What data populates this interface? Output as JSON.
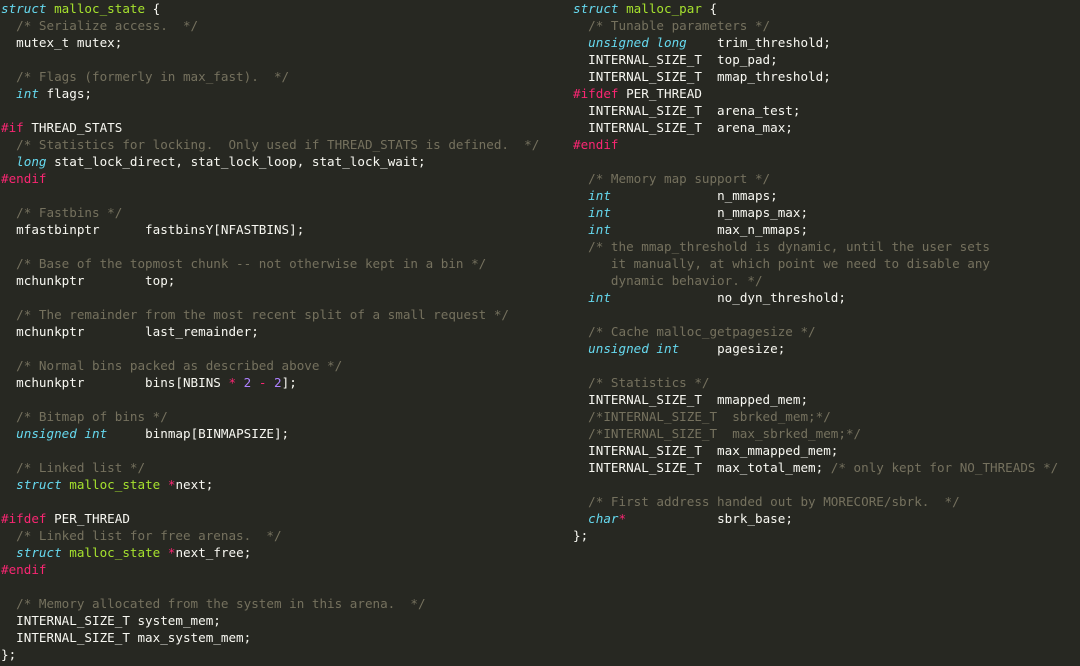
{
  "colors": {
    "background": "#272822",
    "text": "#f8f8f2",
    "keyword": "#66d9ef",
    "type_name": "#a6e22e",
    "comment": "#75715e",
    "preprocessor": "#f92672",
    "number": "#ae81ff"
  },
  "left_pane": {
    "lines": [
      [
        [
          "kw",
          "struct"
        ],
        [
          "pl",
          " "
        ],
        [
          "ty",
          "malloc_state"
        ],
        [
          "pl",
          " {"
        ]
      ],
      [
        [
          "cm",
          "  /* Serialize access.  */"
        ]
      ],
      [
        [
          "pl",
          "  mutex_t mutex;"
        ]
      ],
      [],
      [
        [
          "cm",
          "  /* Flags (formerly in max_fast).  */"
        ]
      ],
      [
        [
          "pl",
          "  "
        ],
        [
          "kw",
          "int"
        ],
        [
          "pl",
          " flags;"
        ]
      ],
      [],
      [
        [
          "pp",
          "#if"
        ],
        [
          "pl",
          " THREAD_STATS"
        ]
      ],
      [
        [
          "cm",
          "  /* Statistics for locking.  Only used if THREAD_STATS is defined.  */"
        ]
      ],
      [
        [
          "pl",
          "  "
        ],
        [
          "kw",
          "long"
        ],
        [
          "pl",
          " stat_lock_direct, stat_lock_loop, stat_lock_wait;"
        ]
      ],
      [
        [
          "pp",
          "#endif"
        ]
      ],
      [],
      [
        [
          "cm",
          "  /* Fastbins */"
        ]
      ],
      [
        [
          "pl",
          "  mfastbinptr      fastbinsY[NFASTBINS];"
        ]
      ],
      [],
      [
        [
          "cm",
          "  /* Base of the topmost chunk -- not otherwise kept in a bin */"
        ]
      ],
      [
        [
          "pl",
          "  mchunkptr        top;"
        ]
      ],
      [],
      [
        [
          "cm",
          "  /* The remainder from the most recent split of a small request */"
        ]
      ],
      [
        [
          "pl",
          "  mchunkptr        last_remainder;"
        ]
      ],
      [],
      [
        [
          "cm",
          "  /* Normal bins packed as described above */"
        ]
      ],
      [
        [
          "pl",
          "  mchunkptr        bins[NBINS "
        ],
        [
          "op",
          "*"
        ],
        [
          "pl",
          " "
        ],
        [
          "nu",
          "2"
        ],
        [
          "pl",
          " "
        ],
        [
          "op",
          "-"
        ],
        [
          "pl",
          " "
        ],
        [
          "nu",
          "2"
        ],
        [
          "pl",
          "];"
        ]
      ],
      [],
      [
        [
          "cm",
          "  /* Bitmap of bins */"
        ]
      ],
      [
        [
          "pl",
          "  "
        ],
        [
          "kw",
          "unsigned int"
        ],
        [
          "pl",
          "     binmap[BINMAPSIZE];"
        ]
      ],
      [],
      [
        [
          "cm",
          "  /* Linked list */"
        ]
      ],
      [
        [
          "pl",
          "  "
        ],
        [
          "kw",
          "struct"
        ],
        [
          "pl",
          " "
        ],
        [
          "ty",
          "malloc_state"
        ],
        [
          "pl",
          " "
        ],
        [
          "op",
          "*"
        ],
        [
          "pl",
          "next;"
        ]
      ],
      [],
      [
        [
          "pp",
          "#ifdef"
        ],
        [
          "pl",
          " PER_THREAD"
        ]
      ],
      [
        [
          "cm",
          "  /* Linked list for free arenas.  */"
        ]
      ],
      [
        [
          "pl",
          "  "
        ],
        [
          "kw",
          "struct"
        ],
        [
          "pl",
          " "
        ],
        [
          "ty",
          "malloc_state"
        ],
        [
          "pl",
          " "
        ],
        [
          "op",
          "*"
        ],
        [
          "pl",
          "next_free;"
        ]
      ],
      [
        [
          "pp",
          "#endif"
        ]
      ],
      [],
      [
        [
          "cm",
          "  /* Memory allocated from the system in this arena.  */"
        ]
      ],
      [
        [
          "pl",
          "  INTERNAL_SIZE_T system_mem;"
        ]
      ],
      [
        [
          "pl",
          "  INTERNAL_SIZE_T max_system_mem;"
        ]
      ],
      [
        [
          "pl",
          "};"
        ]
      ]
    ]
  },
  "right_pane": {
    "lines": [
      [
        [
          "kw",
          "struct"
        ],
        [
          "pl",
          " "
        ],
        [
          "ty",
          "malloc_par"
        ],
        [
          "pl",
          " {"
        ]
      ],
      [
        [
          "cm",
          "  /* Tunable parameters */"
        ]
      ],
      [
        [
          "pl",
          "  "
        ],
        [
          "kw",
          "unsigned long"
        ],
        [
          "pl",
          "    trim_threshold;"
        ]
      ],
      [
        [
          "pl",
          "  INTERNAL_SIZE_T  top_pad;"
        ]
      ],
      [
        [
          "pl",
          "  INTERNAL_SIZE_T  mmap_threshold;"
        ]
      ],
      [
        [
          "pp",
          "#ifdef"
        ],
        [
          "pl",
          " PER_THREAD"
        ]
      ],
      [
        [
          "pl",
          "  INTERNAL_SIZE_T  arena_test;"
        ]
      ],
      [
        [
          "pl",
          "  INTERNAL_SIZE_T  arena_max;"
        ]
      ],
      [
        [
          "pp",
          "#endif"
        ]
      ],
      [],
      [
        [
          "cm",
          "  /* Memory map support */"
        ]
      ],
      [
        [
          "pl",
          "  "
        ],
        [
          "kw",
          "int"
        ],
        [
          "pl",
          "              n_mmaps;"
        ]
      ],
      [
        [
          "pl",
          "  "
        ],
        [
          "kw",
          "int"
        ],
        [
          "pl",
          "              n_mmaps_max;"
        ]
      ],
      [
        [
          "pl",
          "  "
        ],
        [
          "kw",
          "int"
        ],
        [
          "pl",
          "              max_n_mmaps;"
        ]
      ],
      [
        [
          "cm",
          "  /* the mmap_threshold is dynamic, until the user sets"
        ]
      ],
      [
        [
          "cm",
          "     it manually, at which point we need to disable any"
        ]
      ],
      [
        [
          "cm",
          "     dynamic behavior. */"
        ]
      ],
      [
        [
          "pl",
          "  "
        ],
        [
          "kw",
          "int"
        ],
        [
          "pl",
          "              no_dyn_threshold;"
        ]
      ],
      [],
      [
        [
          "cm",
          "  /* Cache malloc_getpagesize */"
        ]
      ],
      [
        [
          "pl",
          "  "
        ],
        [
          "kw",
          "unsigned int"
        ],
        [
          "pl",
          "     pagesize;"
        ]
      ],
      [],
      [
        [
          "cm",
          "  /* Statistics */"
        ]
      ],
      [
        [
          "pl",
          "  INTERNAL_SIZE_T  mmapped_mem;"
        ]
      ],
      [
        [
          "cm",
          "  /*INTERNAL_SIZE_T  sbrked_mem;*/"
        ]
      ],
      [
        [
          "cm",
          "  /*INTERNAL_SIZE_T  max_sbrked_mem;*/"
        ]
      ],
      [
        [
          "pl",
          "  INTERNAL_SIZE_T  max_mmapped_mem;"
        ]
      ],
      [
        [
          "pl",
          "  INTERNAL_SIZE_T  max_total_mem; "
        ],
        [
          "cm",
          "/* only kept for NO_THREADS */"
        ]
      ],
      [],
      [
        [
          "cm",
          "  /* First address handed out by MORECORE/sbrk.  */"
        ]
      ],
      [
        [
          "pl",
          "  "
        ],
        [
          "kw",
          "char"
        ],
        [
          "op",
          "*"
        ],
        [
          "pl",
          "            sbrk_base;"
        ]
      ],
      [
        [
          "pl",
          "};"
        ]
      ]
    ]
  }
}
